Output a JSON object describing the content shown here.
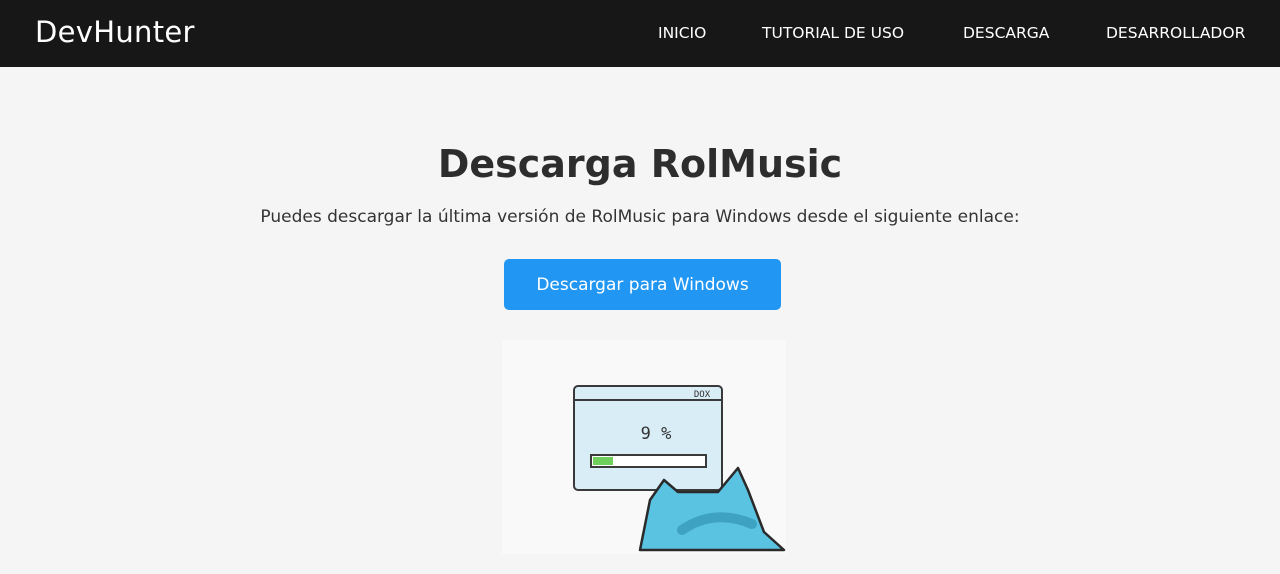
{
  "header": {
    "brand": "DevHunter",
    "nav": [
      {
        "label": "INICIO"
      },
      {
        "label": "TUTORIAL DE USO"
      },
      {
        "label": "DESCARGA"
      },
      {
        "label": "DESARROLLADOR"
      }
    ]
  },
  "main": {
    "title": "Descarga RolMusic",
    "description": "Puedes descargar la última versión de RolMusic para Windows desde el siguiente enlace:",
    "download_button": "Descargar para Windows"
  },
  "illustration": {
    "window_tag": "DOX",
    "progress_label": "9 %",
    "progress_fraction": 0.09,
    "colors": {
      "window_body": "#d9edf7",
      "cat": "#5bc3e2",
      "progress": "#6fcf5c",
      "button": "#2196f3",
      "topbar": "#171717"
    }
  }
}
